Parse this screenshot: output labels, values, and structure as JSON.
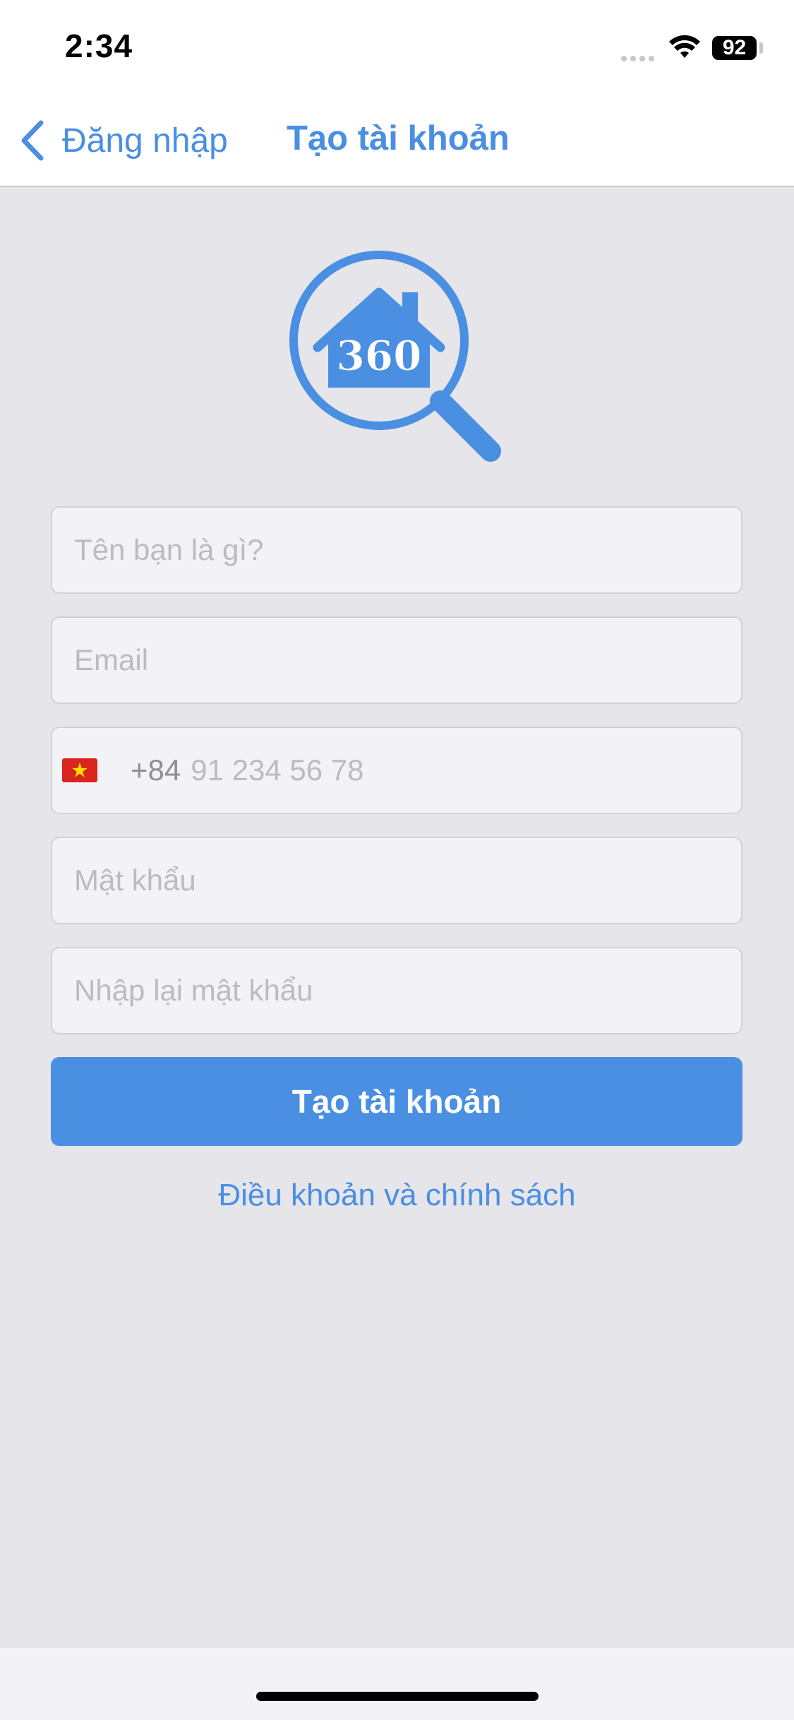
{
  "status_bar": {
    "time": "2:34",
    "battery": "92"
  },
  "nav": {
    "back_label": "Đăng nhập",
    "title": "Tạo tài khoản"
  },
  "logo": {
    "text": "360",
    "color": "#4a8fe2"
  },
  "form": {
    "name_placeholder": "Tên bạn là gì?",
    "email_placeholder": "Email",
    "phone": {
      "country_code": "+84",
      "placeholder": "91 234 56 78",
      "flag": "vietnam-flag-icon"
    },
    "password_placeholder": "Mật khẩu",
    "confirm_password_placeholder": "Nhập lại mật khẩu"
  },
  "actions": {
    "create_account": "Tạo tài khoản",
    "terms_link": "Điều khoản và chính sách"
  },
  "colors": {
    "accent": "#4a8fe2",
    "background": "#e5e5ea",
    "field_bg": "#f2f2f7"
  }
}
